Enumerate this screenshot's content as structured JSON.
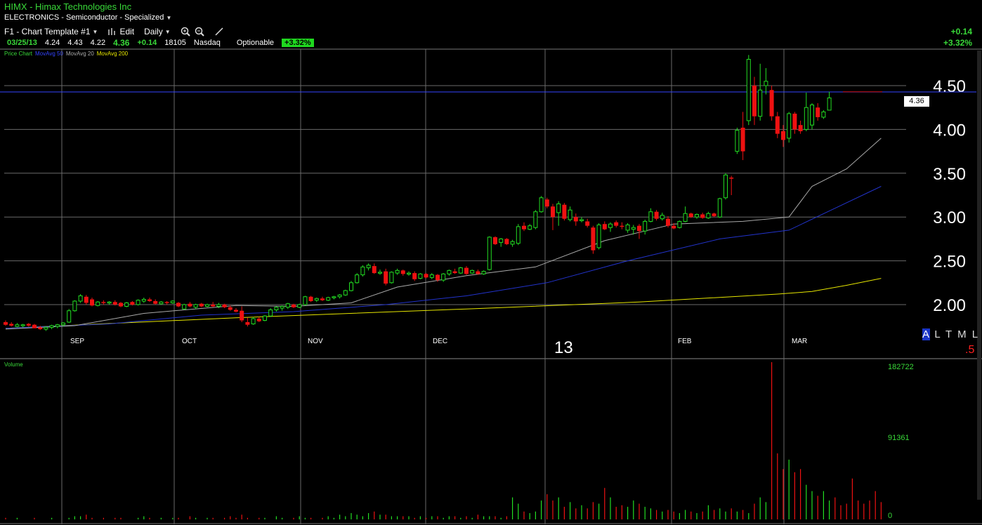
{
  "header": {
    "title": "HIMX - Himax Technologies Inc",
    "sector": "ELECTRONICS - Semiconductor - Specialized"
  },
  "toolbar": {
    "template": "F1 - Chart Template #1",
    "edit": "Edit",
    "period": "Daily"
  },
  "quote": {
    "date": "03/25/13",
    "open": "4.24",
    "high": "4.43",
    "low": "4.22",
    "last": "4.36",
    "change": "+0.14",
    "volume": "18105",
    "exchange": "Nasdaq",
    "optionable": "Optionable",
    "pct_change": "+3.32%"
  },
  "right_quote": {
    "change": "+0.14",
    "pct": "+3.32%"
  },
  "legend": {
    "price": "Price Chart",
    "ma50": "MovAvg 50",
    "ma20": "MovAvg 20",
    "ma200": "MovAvg 200"
  },
  "colors": {
    "up": "#22dd22",
    "down": "#ee1111",
    "ma50": "#2233cc",
    "ma20": "#aaaaaa",
    "ma200": "#e6e600",
    "grid": "#6a6a6a",
    "crosshair": "#3344ff"
  },
  "price_box": "4.36",
  "altml": {
    "selected": "A",
    "rest": "L T M L"
  },
  "red_digit": ".5",
  "year_label": "13",
  "volume_panel": {
    "label": "Volume",
    "ticks": [
      "182722",
      "91361",
      "0"
    ]
  },
  "chart_data": {
    "type": "candlestick",
    "price_axis": {
      "ticks": [
        "4.50",
        "4.00",
        "3.50",
        "3.00",
        "2.50",
        "2.00"
      ],
      "ylim": [
        1.55,
        4.95
      ]
    },
    "month_labels": [
      "SEP",
      "OCT",
      "NOV",
      "DEC",
      "FEB",
      "MAR"
    ],
    "highlight_price": 4.43,
    "candles": [
      {
        "o": 1.8,
        "h": 1.82,
        "l": 1.76,
        "c": 1.77
      },
      {
        "o": 1.78,
        "h": 1.8,
        "l": 1.75,
        "c": 1.76
      },
      {
        "o": 1.75,
        "h": 1.79,
        "l": 1.74,
        "c": 1.77
      },
      {
        "o": 1.76,
        "h": 1.78,
        "l": 1.74,
        "c": 1.77
      },
      {
        "o": 1.78,
        "h": 1.79,
        "l": 1.75,
        "c": 1.76
      },
      {
        "o": 1.77,
        "h": 1.78,
        "l": 1.74,
        "c": 1.73
      },
      {
        "o": 1.74,
        "h": 1.76,
        "l": 1.71,
        "c": 1.72
      },
      {
        "o": 1.72,
        "h": 1.75,
        "l": 1.7,
        "c": 1.74
      },
      {
        "o": 1.74,
        "h": 1.77,
        "l": 1.72,
        "c": 1.76
      },
      {
        "o": 1.75,
        "h": 1.78,
        "l": 1.73,
        "c": 1.77
      },
      {
        "o": 1.77,
        "h": 1.8,
        "l": 1.75,
        "c": 1.79
      },
      {
        "o": 1.8,
        "h": 1.95,
        "l": 1.79,
        "c": 1.93
      },
      {
        "o": 1.93,
        "h": 2.05,
        "l": 1.92,
        "c": 2.04
      },
      {
        "o": 2.04,
        "h": 2.12,
        "l": 2.02,
        "c": 2.1
      },
      {
        "o": 2.09,
        "h": 2.11,
        "l": 2.0,
        "c": 2.02
      },
      {
        "o": 2.06,
        "h": 2.08,
        "l": 1.98,
        "c": 1.99
      },
      {
        "o": 1.99,
        "h": 2.04,
        "l": 1.98,
        "c": 2.03
      },
      {
        "o": 2.03,
        "h": 2.05,
        "l": 2.0,
        "c": 2.02
      },
      {
        "o": 2.02,
        "h": 2.04,
        "l": 2.0,
        "c": 2.03
      },
      {
        "o": 2.03,
        "h": 2.05,
        "l": 1.99,
        "c": 2.0
      },
      {
        "o": 2.02,
        "h": 2.03,
        "l": 1.97,
        "c": 1.98
      },
      {
        "o": 1.98,
        "h": 2.03,
        "l": 1.97,
        "c": 2.02
      },
      {
        "o": 2.03,
        "h": 2.04,
        "l": 1.99,
        "c": 2.0
      },
      {
        "o": 2.0,
        "h": 2.06,
        "l": 1.99,
        "c": 2.05
      },
      {
        "o": 2.04,
        "h": 2.08,
        "l": 2.02,
        "c": 2.06
      },
      {
        "o": 2.06,
        "h": 2.08,
        "l": 2.03,
        "c": 2.04
      },
      {
        "o": 2.04,
        "h": 2.06,
        "l": 2.0,
        "c": 2.01
      },
      {
        "o": 2.01,
        "h": 2.04,
        "l": 2.0,
        "c": 2.03
      },
      {
        "o": 2.03,
        "h": 2.04,
        "l": 2.0,
        "c": 2.02
      },
      {
        "o": 2.02,
        "h": 2.05,
        "l": 2.01,
        "c": 2.04
      },
      {
        "o": 2.02,
        "h": 2.03,
        "l": 1.97,
        "c": 1.98
      },
      {
        "o": 1.95,
        "h": 2.01,
        "l": 1.94,
        "c": 2.0
      },
      {
        "o": 2.01,
        "h": 2.03,
        "l": 1.97,
        "c": 1.98
      },
      {
        "o": 1.97,
        "h": 2.01,
        "l": 1.95,
        "c": 2.0
      },
      {
        "o": 2.01,
        "h": 2.02,
        "l": 1.97,
        "c": 1.98
      },
      {
        "o": 1.98,
        "h": 2.01,
        "l": 1.97,
        "c": 2.0
      },
      {
        "o": 2.0,
        "h": 2.03,
        "l": 1.97,
        "c": 1.98
      },
      {
        "o": 1.98,
        "h": 2.02,
        "l": 1.96,
        "c": 2.0
      },
      {
        "o": 2.0,
        "h": 2.01,
        "l": 1.96,
        "c": 1.97
      },
      {
        "o": 1.97,
        "h": 1.99,
        "l": 1.93,
        "c": 1.94
      },
      {
        "o": 1.94,
        "h": 1.96,
        "l": 1.91,
        "c": 1.92
      },
      {
        "o": 1.93,
        "h": 1.98,
        "l": 1.8,
        "c": 1.82
      },
      {
        "o": 1.8,
        "h": 1.85,
        "l": 1.75,
        "c": 1.77
      },
      {
        "o": 1.78,
        "h": 1.86,
        "l": 1.77,
        "c": 1.84
      },
      {
        "o": 1.84,
        "h": 1.86,
        "l": 1.8,
        "c": 1.81
      },
      {
        "o": 1.82,
        "h": 1.88,
        "l": 1.81,
        "c": 1.87
      },
      {
        "o": 1.87,
        "h": 1.96,
        "l": 1.86,
        "c": 1.94
      },
      {
        "o": 1.94,
        "h": 1.98,
        "l": 1.92,
        "c": 1.97
      },
      {
        "o": 1.96,
        "h": 1.99,
        "l": 1.93,
        "c": 1.98
      },
      {
        "o": 1.97,
        "h": 2.02,
        "l": 1.95,
        "c": 2.01
      },
      {
        "o": 2.0,
        "h": 2.01,
        "l": 1.96,
        "c": 1.97
      },
      {
        "o": 1.97,
        "h": 2.01,
        "l": 1.96,
        "c": 2.0
      },
      {
        "o": 2.0,
        "h": 2.1,
        "l": 1.99,
        "c": 2.09
      },
      {
        "o": 2.09,
        "h": 2.1,
        "l": 2.03,
        "c": 2.04
      },
      {
        "o": 2.05,
        "h": 2.08,
        "l": 2.03,
        "c": 2.07
      },
      {
        "o": 2.07,
        "h": 2.09,
        "l": 2.04,
        "c": 2.05
      },
      {
        "o": 2.05,
        "h": 2.09,
        "l": 2.04,
        "c": 2.08
      },
      {
        "o": 2.08,
        "h": 2.1,
        "l": 2.06,
        "c": 2.09
      },
      {
        "o": 2.09,
        "h": 2.12,
        "l": 2.07,
        "c": 2.11
      },
      {
        "o": 2.11,
        "h": 2.17,
        "l": 2.1,
        "c": 2.16
      },
      {
        "o": 2.16,
        "h": 2.27,
        "l": 2.15,
        "c": 2.25
      },
      {
        "o": 2.25,
        "h": 2.36,
        "l": 2.24,
        "c": 2.34
      },
      {
        "o": 2.34,
        "h": 2.45,
        "l": 2.32,
        "c": 2.43
      },
      {
        "o": 2.42,
        "h": 2.47,
        "l": 2.39,
        "c": 2.45
      },
      {
        "o": 2.44,
        "h": 2.47,
        "l": 2.35,
        "c": 2.36
      },
      {
        "o": 2.36,
        "h": 2.4,
        "l": 2.34,
        "c": 2.37
      },
      {
        "o": 2.38,
        "h": 2.41,
        "l": 2.22,
        "c": 2.24
      },
      {
        "o": 2.25,
        "h": 2.38,
        "l": 2.24,
        "c": 2.37
      },
      {
        "o": 2.36,
        "h": 2.41,
        "l": 2.34,
        "c": 2.39
      },
      {
        "o": 2.39,
        "h": 2.4,
        "l": 2.33,
        "c": 2.35
      },
      {
        "o": 2.35,
        "h": 2.38,
        "l": 2.33,
        "c": 2.36
      },
      {
        "o": 2.36,
        "h": 2.38,
        "l": 2.27,
        "c": 2.29
      },
      {
        "o": 2.3,
        "h": 2.36,
        "l": 2.29,
        "c": 2.35
      },
      {
        "o": 2.35,
        "h": 2.36,
        "l": 2.3,
        "c": 2.31
      },
      {
        "o": 2.31,
        "h": 2.36,
        "l": 2.29,
        "c": 2.34
      },
      {
        "o": 2.34,
        "h": 2.35,
        "l": 2.26,
        "c": 2.28
      },
      {
        "o": 2.28,
        "h": 2.36,
        "l": 2.26,
        "c": 2.35
      },
      {
        "o": 2.35,
        "h": 2.4,
        "l": 2.33,
        "c": 2.39
      },
      {
        "o": 2.38,
        "h": 2.41,
        "l": 2.35,
        "c": 2.36
      },
      {
        "o": 2.36,
        "h": 2.43,
        "l": 2.35,
        "c": 2.42
      },
      {
        "o": 2.42,
        "h": 2.44,
        "l": 2.34,
        "c": 2.35
      },
      {
        "o": 2.36,
        "h": 2.4,
        "l": 2.35,
        "c": 2.39
      },
      {
        "o": 2.38,
        "h": 2.4,
        "l": 2.34,
        "c": 2.35
      },
      {
        "o": 2.35,
        "h": 2.39,
        "l": 2.34,
        "c": 2.38
      },
      {
        "o": 2.4,
        "h": 2.78,
        "l": 2.39,
        "c": 2.77
      },
      {
        "o": 2.77,
        "h": 2.78,
        "l": 2.68,
        "c": 2.69
      },
      {
        "o": 2.71,
        "h": 2.76,
        "l": 2.66,
        "c": 2.75
      },
      {
        "o": 2.75,
        "h": 2.76,
        "l": 2.68,
        "c": 2.69
      },
      {
        "o": 2.69,
        "h": 2.74,
        "l": 2.66,
        "c": 2.72
      },
      {
        "o": 2.7,
        "h": 2.92,
        "l": 2.68,
        "c": 2.89
      },
      {
        "o": 2.9,
        "h": 2.94,
        "l": 2.84,
        "c": 2.86
      },
      {
        "o": 2.86,
        "h": 2.92,
        "l": 2.85,
        "c": 2.9
      },
      {
        "o": 2.88,
        "h": 3.08,
        "l": 2.86,
        "c": 3.06
      },
      {
        "o": 3.06,
        "h": 3.24,
        "l": 3.05,
        "c": 3.22
      },
      {
        "o": 3.2,
        "h": 3.22,
        "l": 3.1,
        "c": 3.12
      },
      {
        "o": 3.12,
        "h": 3.15,
        "l": 2.85,
        "c": 3.0
      },
      {
        "o": 3.05,
        "h": 3.18,
        "l": 2.9,
        "c": 3.15
      },
      {
        "o": 3.14,
        "h": 3.16,
        "l": 2.96,
        "c": 2.98
      },
      {
        "o": 2.97,
        "h": 3.12,
        "l": 2.95,
        "c": 3.08
      },
      {
        "o": 3.0,
        "h": 3.04,
        "l": 2.9,
        "c": 2.95
      },
      {
        "o": 2.96,
        "h": 3.0,
        "l": 2.94,
        "c": 2.97
      },
      {
        "o": 2.95,
        "h": 2.98,
        "l": 2.88,
        "c": 2.9
      },
      {
        "o": 2.88,
        "h": 2.9,
        "l": 2.58,
        "c": 2.62
      },
      {
        "o": 2.65,
        "h": 2.93,
        "l": 2.63,
        "c": 2.91
      },
      {
        "o": 2.92,
        "h": 2.95,
        "l": 2.85,
        "c": 2.86
      },
      {
        "o": 2.88,
        "h": 2.94,
        "l": 2.83,
        "c": 2.92
      },
      {
        "o": 2.94,
        "h": 2.96,
        "l": 2.88,
        "c": 2.9
      },
      {
        "o": 2.9,
        "h": 2.94,
        "l": 2.86,
        "c": 2.89
      },
      {
        "o": 2.85,
        "h": 2.93,
        "l": 2.82,
        "c": 2.91
      },
      {
        "o": 2.86,
        "h": 2.91,
        "l": 2.8,
        "c": 2.88
      },
      {
        "o": 2.9,
        "h": 2.92,
        "l": 2.75,
        "c": 2.84
      },
      {
        "o": 2.84,
        "h": 2.97,
        "l": 2.8,
        "c": 2.95
      },
      {
        "o": 2.95,
        "h": 3.1,
        "l": 2.94,
        "c": 3.06
      },
      {
        "o": 3.06,
        "h": 3.08,
        "l": 2.96,
        "c": 2.98
      },
      {
        "o": 2.98,
        "h": 3.05,
        "l": 2.96,
        "c": 3.02
      },
      {
        "o": 2.98,
        "h": 3.01,
        "l": 2.88,
        "c": 2.9
      },
      {
        "o": 2.9,
        "h": 2.93,
        "l": 2.86,
        "c": 2.87
      },
      {
        "o": 2.88,
        "h": 2.96,
        "l": 2.87,
        "c": 2.95
      },
      {
        "o": 2.95,
        "h": 3.12,
        "l": 2.94,
        "c": 3.04
      },
      {
        "o": 3.04,
        "h": 3.05,
        "l": 2.99,
        "c": 3.0
      },
      {
        "o": 3.0,
        "h": 3.04,
        "l": 2.98,
        "c": 3.03
      },
      {
        "o": 3.03,
        "h": 3.05,
        "l": 2.98,
        "c": 2.99
      },
      {
        "o": 2.99,
        "h": 3.06,
        "l": 2.98,
        "c": 3.04
      },
      {
        "o": 3.04,
        "h": 3.05,
        "l": 3.0,
        "c": 3.01
      },
      {
        "o": 3.0,
        "h": 3.22,
        "l": 2.99,
        "c": 3.21
      },
      {
        "o": 3.22,
        "h": 3.5,
        "l": 3.2,
        "c": 3.48
      },
      {
        "o": 3.45,
        "h": 3.47,
        "l": 3.25,
        "c": 3.44
      },
      {
        "o": 3.75,
        "h": 4.02,
        "l": 3.72,
        "c": 3.99
      },
      {
        "o": 4.02,
        "h": 4.2,
        "l": 3.65,
        "c": 3.75
      },
      {
        "o": 4.1,
        "h": 4.85,
        "l": 4.05,
        "c": 4.8
      },
      {
        "o": 4.5,
        "h": 4.6,
        "l": 4.05,
        "c": 4.15
      },
      {
        "o": 4.15,
        "h": 4.75,
        "l": 4.1,
        "c": 4.45
      },
      {
        "o": 4.5,
        "h": 4.7,
        "l": 4.4,
        "c": 4.55
      },
      {
        "o": 4.45,
        "h": 4.5,
        "l": 4.1,
        "c": 4.15
      },
      {
        "o": 4.15,
        "h": 4.2,
        "l": 3.9,
        "c": 3.95
      },
      {
        "o": 3.98,
        "h": 4.05,
        "l": 3.8,
        "c": 3.88
      },
      {
        "o": 3.9,
        "h": 4.2,
        "l": 3.85,
        "c": 4.18
      },
      {
        "o": 4.18,
        "h": 4.2,
        "l": 3.95,
        "c": 4.0
      },
      {
        "o": 4.05,
        "h": 4.1,
        "l": 3.95,
        "c": 3.98
      },
      {
        "o": 4.0,
        "h": 4.42,
        "l": 3.98,
        "c": 4.25
      },
      {
        "o": 4.05,
        "h": 4.3,
        "l": 4.0,
        "c": 4.28
      },
      {
        "o": 4.25,
        "h": 4.3,
        "l": 4.1,
        "c": 4.14
      },
      {
        "o": 4.14,
        "h": 4.22,
        "l": 4.12,
        "c": 4.2
      },
      {
        "o": 4.22,
        "h": 4.43,
        "l": 4.22,
        "c": 4.36
      }
    ],
    "ma20": [
      [
        0,
        1.72
      ],
      [
        12,
        1.76
      ],
      [
        24,
        1.9
      ],
      [
        40,
        1.99
      ],
      [
        50,
        1.98
      ],
      [
        60,
        2.02
      ],
      [
        68,
        2.2
      ],
      [
        80,
        2.33
      ],
      [
        92,
        2.43
      ],
      [
        104,
        2.73
      ],
      [
        116,
        2.92
      ],
      [
        128,
        2.95
      ],
      [
        136,
        3.0
      ],
      [
        140,
        3.35
      ],
      [
        146,
        3.55
      ],
      [
        152,
        3.9
      ]
    ],
    "ma50": [
      [
        0,
        1.73
      ],
      [
        18,
        1.78
      ],
      [
        34,
        1.88
      ],
      [
        50,
        1.92
      ],
      [
        66,
        2.0
      ],
      [
        80,
        2.1
      ],
      [
        94,
        2.25
      ],
      [
        108,
        2.5
      ],
      [
        124,
        2.75
      ],
      [
        136,
        2.85
      ],
      [
        144,
        3.1
      ],
      [
        152,
        3.35
      ]
    ],
    "ma200": [
      [
        0,
        1.73
      ],
      [
        40,
        1.85
      ],
      [
        80,
        1.95
      ],
      [
        110,
        2.03
      ],
      [
        134,
        2.12
      ],
      [
        140,
        2.15
      ],
      [
        146,
        2.22
      ],
      [
        152,
        2.3
      ]
    ],
    "volume": [
      1,
      0,
      1,
      0,
      0,
      1,
      0,
      0,
      1,
      0,
      0,
      1,
      2,
      2,
      3,
      1,
      0,
      1,
      0,
      1,
      1,
      0,
      0,
      1,
      2,
      1,
      0,
      1,
      0,
      1,
      1,
      0,
      2,
      1,
      0,
      1,
      1,
      0,
      1,
      2,
      1,
      3,
      1,
      0,
      1,
      1,
      0,
      2,
      1,
      0,
      1,
      2,
      1,
      1,
      0,
      1,
      2,
      1,
      3,
      2,
      4,
      3,
      2,
      4,
      5,
      3,
      3,
      2,
      2,
      2,
      2,
      1,
      2,
      1,
      2,
      2,
      1,
      2,
      2,
      1,
      2,
      1,
      3,
      2,
      2,
      2,
      1,
      2,
      14,
      10,
      5,
      4,
      5,
      12,
      16,
      12,
      14,
      8,
      11,
      7,
      9,
      7,
      11,
      10,
      20,
      14,
      8,
      9,
      8,
      12,
      10,
      8,
      7,
      6,
      5,
      6,
      5,
      4,
      6,
      5,
      4,
      5,
      9,
      6,
      7,
      5,
      7,
      5,
      6,
      4,
      10,
      14,
      11,
      100,
      42,
      32,
      38,
      30,
      32,
      22,
      18,
      15,
      18,
      12,
      14,
      9,
      10,
      26,
      12,
      10,
      12,
      18,
      11
    ],
    "volume_ylim": [
      0,
      182722
    ]
  }
}
